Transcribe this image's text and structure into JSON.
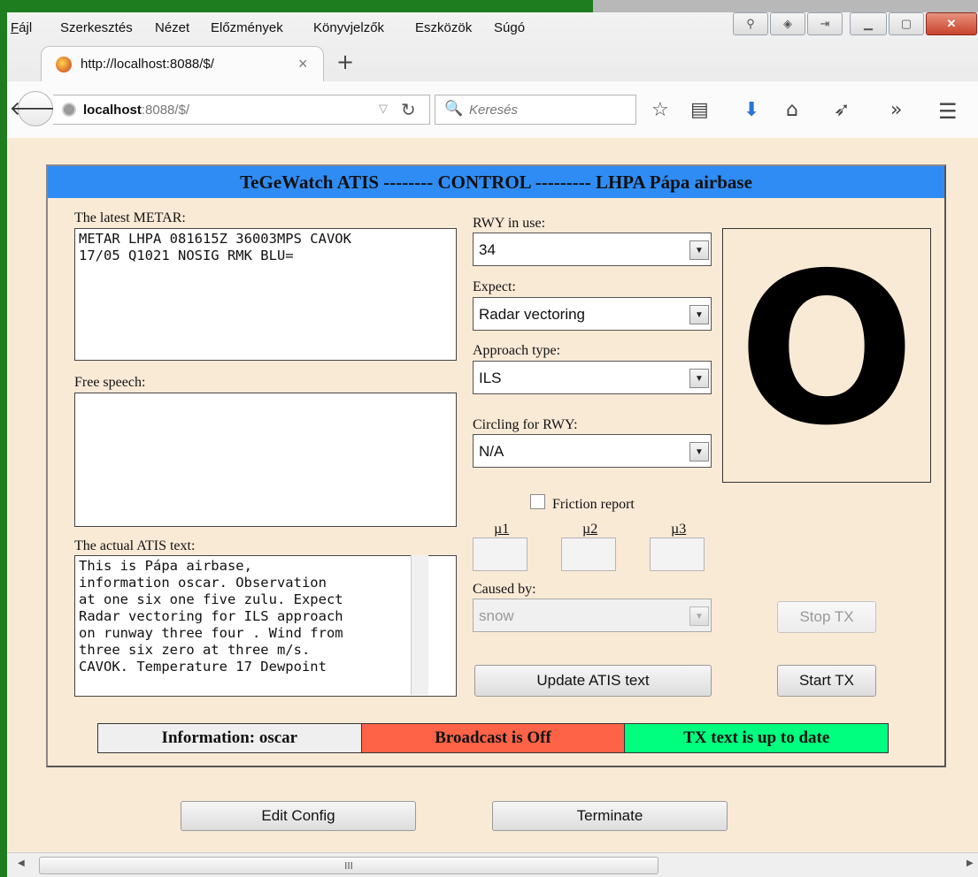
{
  "menubar": {
    "items": [
      "Fájl",
      "Szerkesztés",
      "Nézet",
      "Előzmények",
      "Könyvjelzők",
      "Eszközök",
      "Súgó"
    ]
  },
  "tab": {
    "title": "http://localhost:8088/$/",
    "close": "×",
    "new_tab": "+"
  },
  "navbar": {
    "url_host": "localhost",
    "url_rest": ":8088/$/",
    "search_placeholder": "Keresés"
  },
  "panel": {
    "header": "TeGeWatch ATIS -------- CONTROL --------- LHPA Pápa airbase",
    "metar_label": "The latest METAR:",
    "metar_text": "METAR LHPA 081615Z 36003MPS CAVOK\n17/05 Q1021 NOSIG RMK BLU=",
    "free_speech_label": "Free speech:",
    "free_speech_text": "",
    "atis_label": "The actual ATIS text:",
    "atis_text": "This is Pápa airbase,\ninformation oscar. Observation\nat one six one five zulu. Expect\nRadar vectoring for ILS approach\non runway three four . Wind from\nthree six zero at three m/s.\nCAVOK. Temperature 17 Dewpoint",
    "rwy_label": "RWY in use:",
    "rwy_value": "34",
    "expect_label": "Expect:",
    "expect_value": "Radar vectoring",
    "approach_label": "Approach type:",
    "approach_value": "ILS",
    "circling_label": "Circling for RWY:",
    "circling_value": "N/A",
    "friction_label": "Friction report",
    "friction_checked": false,
    "mu1": "µ1",
    "mu2": "µ2",
    "mu3": "µ3",
    "caused_by_label": "Caused by:",
    "caused_by_value": "snow",
    "update_button": "Update ATIS text",
    "stop_tx_button": "Stop TX",
    "start_tx_button": "Start TX",
    "information_letter": "O"
  },
  "status": {
    "information": "Information: oscar",
    "broadcast": "Broadcast is Off",
    "tx_text": "TX text is up to date",
    "colors": {
      "information": "#efefef",
      "broadcast": "#ff6347",
      "tx_text": "#00ff7f"
    }
  },
  "footer": {
    "edit_config_button": "Edit Config",
    "terminate_button": "Terminate"
  },
  "scrollbar": {
    "grip": "III"
  }
}
